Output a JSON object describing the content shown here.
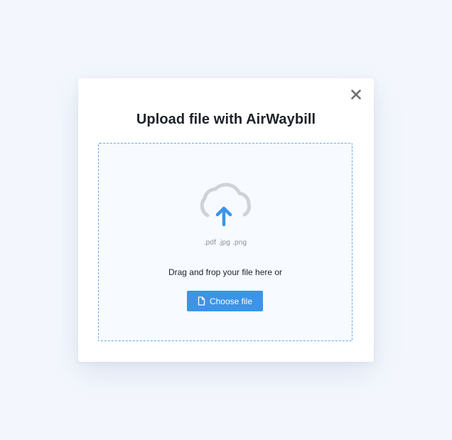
{
  "dialog": {
    "title": "Upload file with AirWaybill",
    "close_icon": "close-icon"
  },
  "dropzone": {
    "icon": "cloud-upload-icon",
    "formats": ".pdf .jpg .png",
    "instruction": "Drag and frop your file here or",
    "choose_button_label": "Choose file",
    "choose_button_icon": "file-icon"
  },
  "colors": {
    "background": "#f3f7fd",
    "accent": "#3b94e8",
    "dropzone_border": "#6aa8e6",
    "cloud_outline": "#cfd2d6"
  }
}
